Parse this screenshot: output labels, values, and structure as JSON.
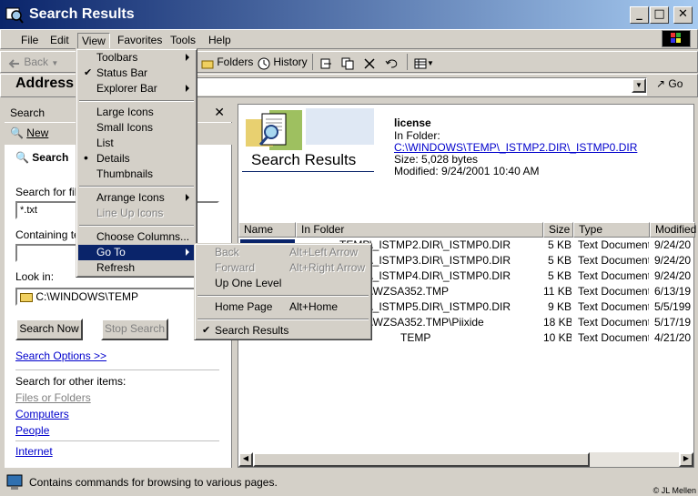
{
  "window": {
    "title": "Search Results"
  },
  "menubar": [
    "File",
    "Edit",
    "View",
    "Favorites",
    "Tools",
    "Help"
  ],
  "toolbar": {
    "back": "Back",
    "folders": "Folders",
    "history": "History"
  },
  "addressbar": {
    "label": "Address",
    "go": "Go"
  },
  "view_menu": {
    "items": [
      {
        "label": "Toolbars"
      },
      {
        "label": "Status Bar"
      },
      {
        "label": "Explorer Bar"
      },
      {
        "label": "Large Icons"
      },
      {
        "label": "Small Icons"
      },
      {
        "label": "List"
      },
      {
        "label": "Details"
      },
      {
        "label": "Thumbnails"
      },
      {
        "label": "Arrange Icons"
      },
      {
        "label": "Line Up Icons"
      },
      {
        "label": "Choose Columns..."
      },
      {
        "label": "Go To"
      },
      {
        "label": "Refresh"
      }
    ]
  },
  "goto_menu": {
    "items": [
      {
        "label": "Back",
        "shortcut": "Alt+Left Arrow"
      },
      {
        "label": "Forward",
        "shortcut": "Alt+Right Arrow"
      },
      {
        "label": "Up One Level",
        "shortcut": ""
      },
      {
        "label": "Home Page",
        "shortcut": "Alt+Home"
      },
      {
        "label": "Search Results",
        "shortcut": ""
      }
    ]
  },
  "search_pane": {
    "header": "Search",
    "new_label": "New",
    "search_title": "Search",
    "search_for_label": "Search for file",
    "search_for_value": "*.txt",
    "containing_label": "Containing te",
    "containing_value": "",
    "look_in_label": "Look in:",
    "look_in_value": "C:\\WINDOWS\\TEMP",
    "search_now": "Search Now",
    "stop_search": "Stop Search",
    "search_options": "Search Options >>",
    "other_items_label": "Search for other items:",
    "links": [
      "Files or Folders",
      "Computers",
      "People",
      "Internet"
    ]
  },
  "results": {
    "banner_title": "Search Results",
    "selected_name": "license",
    "in_folder_label": "In Folder:",
    "in_folder_value": "C:\\WINDOWS\\TEMP\\_ISTMP2.DIR\\_ISTMP0.DIR",
    "size_line": "Size: 5,028 bytes",
    "modified_line": "Modified: 9/24/2001 10:40 AM",
    "columns": [
      "Name",
      "In Folder",
      "Size",
      "Type",
      "Modified"
    ],
    "rows": [
      {
        "name": "",
        "folder": "TEMP\\_ISTMP2.DIR\\_ISTMP0.DIR",
        "size": "5 KB",
        "type": "Text Document",
        "modified": "9/24/20"
      },
      {
        "name": "",
        "folder": "TEMP\\_ISTMP3.DIR\\_ISTMP0.DIR",
        "size": "5 KB",
        "type": "Text Document",
        "modified": "9/24/20"
      },
      {
        "name": "",
        "folder": "TEMP\\_ISTMP4.DIR\\_ISTMP0.DIR",
        "size": "5 KB",
        "type": "Text Document",
        "modified": "9/24/20"
      },
      {
        "name": "",
        "folder": "TEMP\\WZSA352.TMP",
        "size": "11 KB",
        "type": "Text Document",
        "modified": "6/13/19"
      },
      {
        "name": "",
        "folder": "TEMP\\_ISTMP5.DIR\\_ISTMP0.DIR",
        "size": "9 KB",
        "type": "Text Document",
        "modified": "5/5/199"
      },
      {
        "name": "",
        "folder": "TEMP\\WZSA352.TMP\\Piixide",
        "size": "18 KB",
        "type": "Text Document",
        "modified": "5/17/19"
      },
      {
        "name": "",
        "folder": "TEMP",
        "size": "10 KB",
        "type": "Text Document",
        "modified": "4/21/20"
      }
    ]
  },
  "statusbar": {
    "text": "Contains commands for browsing to various pages.",
    "credit": "© JL Mellen"
  }
}
